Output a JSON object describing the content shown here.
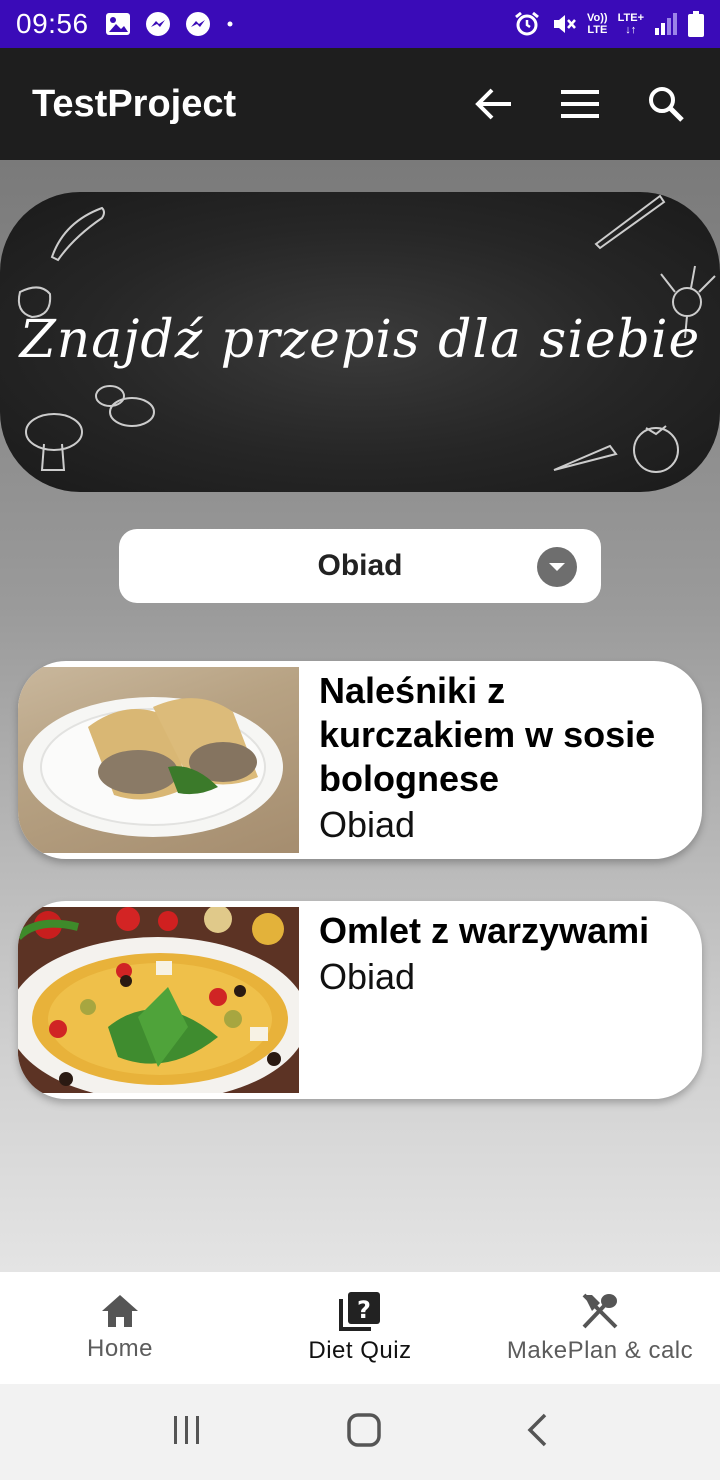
{
  "status_bar": {
    "time": "09:56",
    "volte": "Vo))",
    "volte_sub": "LTE",
    "network": "LTE+",
    "background_color": "#3a0bb8"
  },
  "app_bar": {
    "title": "TestProject",
    "icons": [
      "back-arrow-icon",
      "menu-icon",
      "search-icon"
    ]
  },
  "banner": {
    "text": "Znajdź przepis dla siebie"
  },
  "filter": {
    "selected": "Obiad"
  },
  "recipes": [
    {
      "title": "Naleśniki z kurczakiem w sosie bolognese",
      "category": "Obiad",
      "image": "pancake-rolls-photo"
    },
    {
      "title": "Omlet z warzywami",
      "category": "Obiad",
      "image": "vegetable-omelette-photo"
    }
  ],
  "bottom_nav": {
    "items": [
      {
        "label": "Home",
        "icon": "home-icon"
      },
      {
        "label": "Diet Quiz",
        "icon": "quiz-icon",
        "active": true
      },
      {
        "label": "MakePlan & calc",
        "icon": "fork-spoon-icon"
      }
    ]
  },
  "system_nav": [
    "recent-apps-icon",
    "home-circle-icon",
    "back-chevron-icon"
  ]
}
